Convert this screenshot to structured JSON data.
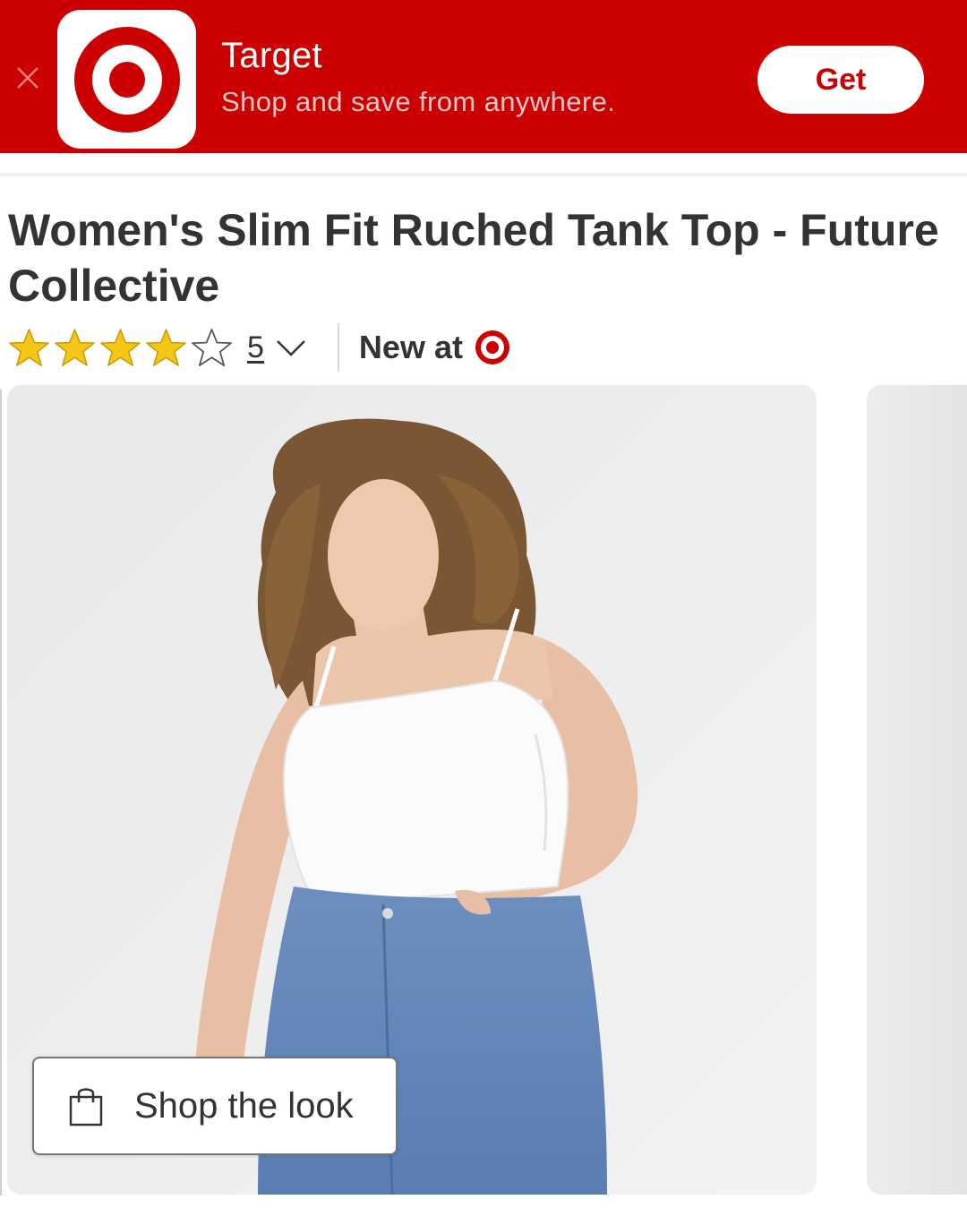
{
  "banner": {
    "app_name": "Target",
    "tagline": "Shop and save from anywhere.",
    "get_label": "Get",
    "close_icon": "close-icon",
    "brand_color": "#cc0000"
  },
  "product": {
    "title": "Women's Slim Fit Ruched Tank Top - Future Collective",
    "rating": {
      "stars_filled": 4,
      "stars_total": 5,
      "review_count": "5"
    },
    "new_at_label": "New at",
    "new_at_logo": "target-bullseye-logo"
  },
  "gallery": {
    "shop_the_look_label": "Shop the look",
    "shop_icon": "shopping-bag-icon"
  },
  "colors": {
    "star": "#f5c518",
    "text": "#333333",
    "accent": "#cc0000"
  }
}
